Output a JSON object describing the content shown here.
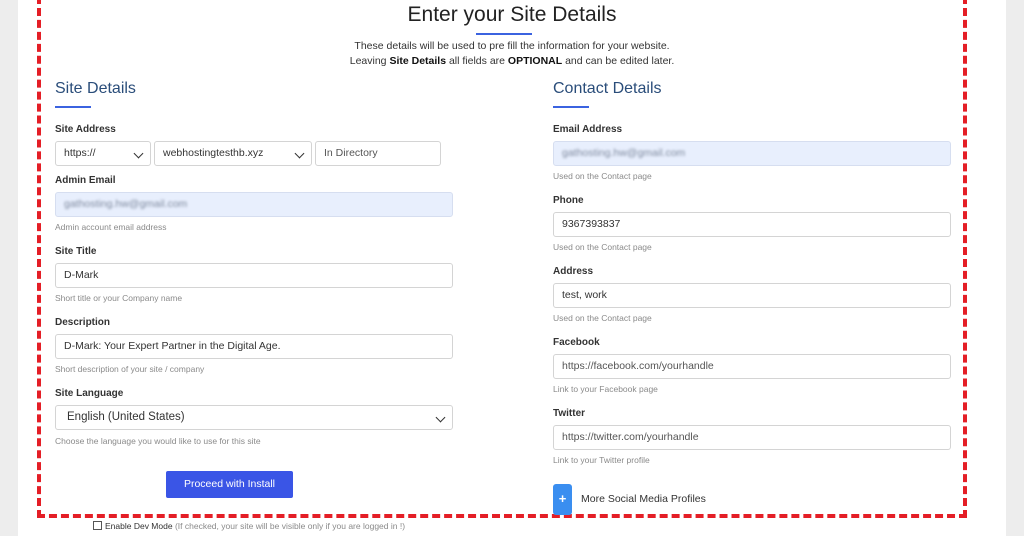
{
  "page": {
    "title": "Enter your Site Details",
    "intro_line1": "These details will be used to pre fill the information for your website.",
    "intro_line2_a": "Leaving ",
    "intro_line2_b": "Site Details",
    "intro_line2_c": " all fields are ",
    "intro_line2_d": "OPTIONAL",
    "intro_line2_e": " and can be edited later."
  },
  "site_details": {
    "heading": "Site Details",
    "site_address": {
      "label": "Site Address",
      "protocol": "https://",
      "domain": "webhostingtesthb.xyz",
      "directory_placeholder": "In Directory"
    },
    "admin_email": {
      "label": "Admin Email",
      "value": "gathosting.hw@gmail.com",
      "help": "Admin account email address"
    },
    "site_title": {
      "label": "Site Title",
      "value": "D-Mark",
      "help": "Short title or your Company name"
    },
    "description": {
      "label": "Description",
      "value": "D-Mark: Your Expert Partner in the Digital Age.",
      "help": "Short description of your site / company"
    },
    "site_language": {
      "label": "Site Language",
      "value": "English (United States)",
      "help": "Choose the language you would like to use for this site"
    },
    "proceed_button": "Proceed with Install"
  },
  "contact_details": {
    "heading": "Contact Details",
    "email": {
      "label": "Email Address",
      "value": "gathosting.hw@gmail.com",
      "help": "Used on the Contact page"
    },
    "phone": {
      "label": "Phone",
      "value": "9367393837",
      "help": "Used on the Contact page"
    },
    "address": {
      "label": "Address",
      "value": "test, work",
      "help": "Used on the Contact page"
    },
    "facebook": {
      "label": "Facebook",
      "placeholder": "https://facebook.com/yourhandle",
      "help": "Link to your Facebook page"
    },
    "twitter": {
      "label": "Twitter",
      "placeholder": "https://twitter.com/yourhandle",
      "help": "Link to your Twitter profile"
    },
    "more_social": {
      "icon": "plus-icon",
      "label": "More Social Media Profiles"
    }
  },
  "dev_mode": {
    "label": "Enable Dev Mode",
    "note": "(If checked, your site will be visible only if you are logged in !)"
  },
  "colors": {
    "accent": "#3a55e6",
    "highlight_border": "#e41e26",
    "filled_field": "#e8effd"
  }
}
